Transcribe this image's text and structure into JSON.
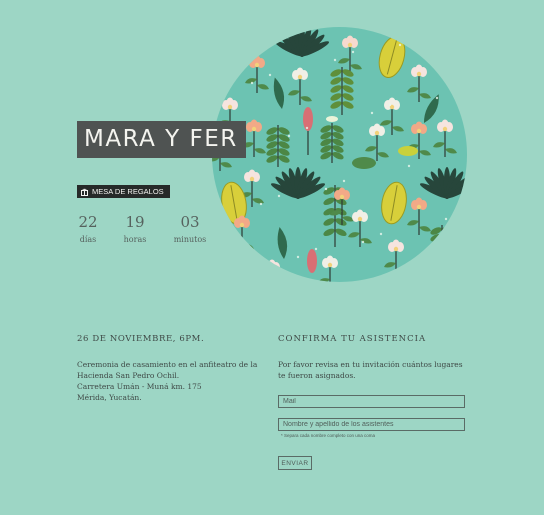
{
  "couple": {
    "names": "MARA Y FER"
  },
  "registry": {
    "label": "MESA DE REGALOS",
    "icon": "gift-icon"
  },
  "countdown": [
    {
      "value": "22",
      "label": "días"
    },
    {
      "value": "19",
      "label": "horas"
    },
    {
      "value": "03",
      "label": "minutos"
    }
  ],
  "event": {
    "date": "26 DE NOVIEMBRE, 6PM.",
    "lines": [
      "Ceremonia de casamiento en el anfiteatro de la",
      "Hacienda San Pedro Ochil.",
      "Carretera Umán - Muná km. 175",
      "Mérida, Yucatán."
    ]
  },
  "rsvp": {
    "title": "CONFIRMA TU ASISTENCIA",
    "lines": [
      "Por favor revisa en tu invitación cuántos lugares",
      "te fueron asignados."
    ],
    "mail_placeholder": "Mail",
    "names_placeholder": "Nombre y apellido de los asistentes",
    "hint": "* Separa cada nombre completo con una coma",
    "submit_label": "ENVIAR"
  },
  "colors": {
    "background": "#9dd6c5",
    "circle": "#6cc3b2",
    "name_badge": "#4f5352",
    "registry_button": "#262a29"
  }
}
